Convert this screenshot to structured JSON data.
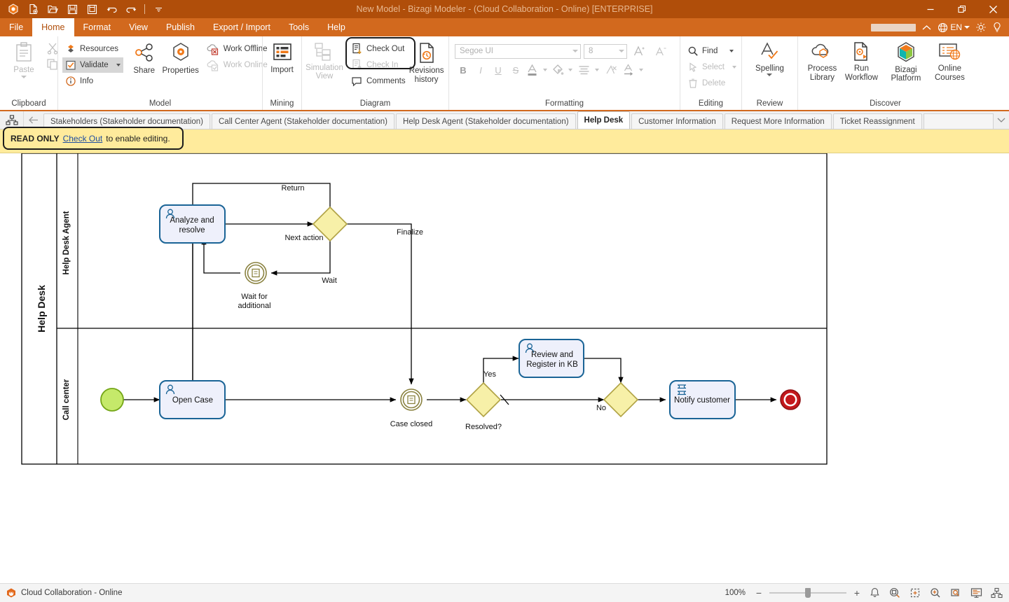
{
  "window": {
    "title": "New Model - Bizagi Modeler - (Cloud Collaboration - Online) [ENTERPRISE]",
    "minimize": "minimize-icon",
    "restore": "restore-icon",
    "close": "close-icon"
  },
  "quick_access": {
    "app_icon": "bizagi-logo-icon",
    "buttons": [
      {
        "name": "new-icon",
        "tooltip": "New"
      },
      {
        "name": "open-icon",
        "tooltip": "Open"
      },
      {
        "name": "save-icon",
        "tooltip": "Save"
      },
      {
        "name": "save-as-icon",
        "tooltip": "Save As"
      },
      {
        "name": "undo-icon",
        "tooltip": "Undo"
      },
      {
        "name": "redo-icon",
        "tooltip": "Redo"
      },
      {
        "name": "customize-qat-icon",
        "tooltip": "Customize Quick Access Toolbar"
      }
    ]
  },
  "menu": {
    "items": [
      {
        "label": "File",
        "active": false
      },
      {
        "label": "Home",
        "active": true
      },
      {
        "label": "Format",
        "active": false
      },
      {
        "label": "View",
        "active": false
      },
      {
        "label": "Publish",
        "active": false
      },
      {
        "label": "Export / Import",
        "active": false
      },
      {
        "label": "Tools",
        "active": false
      },
      {
        "label": "Help",
        "active": false
      }
    ],
    "right": {
      "user_redacted": "",
      "collapse_ribbon": "chevron-up-icon",
      "language": "EN",
      "settings": "gear-icon",
      "help": "lightbulb-icon"
    }
  },
  "ribbon": {
    "groups": [
      {
        "title": "Clipboard",
        "paste": "Paste",
        "cut": "cut-icon",
        "copy": "copy-icon"
      },
      {
        "title": "Model",
        "resources": "Resources",
        "validate": "Validate",
        "info": "Info",
        "share": "Share",
        "properties": "Properties",
        "work_offline": "Work Offline",
        "work_online": "Work Online"
      },
      {
        "title": "Mining",
        "import": "Import"
      },
      {
        "title": "Diagram",
        "simulation_view": "Simulation View",
        "check_out": "Check Out",
        "check_in": "Check In",
        "comments": "Comments",
        "revisions_history": "Revisions history"
      },
      {
        "title": "Formatting",
        "font_name": "Segoe UI",
        "font_size": "8",
        "grow_font": "grow-font-icon",
        "shrink_font": "shrink-font-icon",
        "bold": "B",
        "italic": "I",
        "underline": "U",
        "strikethrough": "S",
        "font_color": "A",
        "fill_color": "fill-color-icon",
        "align": "align-icon",
        "clear_format": "clear-formatting-icon",
        "text_direction": "A"
      },
      {
        "title": "Editing",
        "find": "Find",
        "select": "Select",
        "delete": "Delete"
      },
      {
        "title": "Review",
        "spelling": "Spelling"
      },
      {
        "title": "Discover",
        "process_library": "Process Library",
        "run_workflow": "Run Workflow",
        "bizagi_platform": "Bizagi Platform",
        "online_courses": "Online Courses"
      }
    ]
  },
  "tabbar": {
    "diagram_icon": "diagram-list-icon",
    "back_icon": "back-arrow-icon",
    "tabs": [
      {
        "label": "Stakeholders (Stakeholder documentation)",
        "active": false
      },
      {
        "label": "Call Center Agent  (Stakeholder documentation)",
        "active": false
      },
      {
        "label": "Help Desk Agent  (Stakeholder documentation)",
        "active": false
      },
      {
        "label": "Help Desk",
        "active": true
      },
      {
        "label": "Customer Information",
        "active": false
      },
      {
        "label": "Request More Information",
        "active": false
      },
      {
        "label": "Ticket Reassignment",
        "active": false
      }
    ],
    "overflow_icon": "chevron-down-icon"
  },
  "readonly_bar": {
    "status": "READ ONLY",
    "link": "Check Out",
    "suffix": "to enable editing."
  },
  "diagram": {
    "pool": "Help Desk",
    "lanes": [
      {
        "name": "Help Desk Agent"
      },
      {
        "name": "Call center"
      }
    ],
    "nodes": [
      {
        "id": "start",
        "type": "start-event",
        "label": ""
      },
      {
        "id": "open_case",
        "type": "user-task",
        "label": "Open Case"
      },
      {
        "id": "analyze",
        "type": "user-task",
        "label": "Analyze and resolve"
      },
      {
        "id": "next_action",
        "type": "exclusive-gateway",
        "label": "Next action"
      },
      {
        "id": "wait",
        "type": "intermediate-event",
        "label": "Wait for additional"
      },
      {
        "id": "case_closed",
        "type": "intermediate-event",
        "label": "Case closed"
      },
      {
        "id": "resolved",
        "type": "exclusive-gateway",
        "label": "Resolved?"
      },
      {
        "id": "review_kb",
        "type": "user-task",
        "label": "Review and Register in KB"
      },
      {
        "id": "merge",
        "type": "exclusive-gateway",
        "label": ""
      },
      {
        "id": "notify",
        "type": "script-task",
        "label": "Notify customer"
      },
      {
        "id": "end",
        "type": "end-event",
        "label": ""
      }
    ],
    "flow_labels": {
      "return": "Return",
      "finalize": "Finalize",
      "wait": "Wait",
      "yes": "Yes",
      "no": "No"
    },
    "colors": {
      "task_fill": "#eef0fb",
      "task_stroke": "#1a6496",
      "gateway_fill": "#f7f0a8",
      "gateway_stroke": "#b0a243",
      "start_fill": "#c5e96a",
      "start_stroke": "#74a617",
      "end_fill": "#c4191d",
      "end_stroke": "#8f1114",
      "event_stroke": "#8a8240"
    }
  },
  "statusbar": {
    "connection_icon": "cloud-lock-icon",
    "connection_label": "Cloud Collaboration - Online",
    "zoom_level": "100%",
    "zoom_out": "−",
    "zoom_in": "+",
    "icons": [
      {
        "name": "notifications-bell-icon"
      },
      {
        "name": "fit-page-icon"
      },
      {
        "name": "fit-width-icon"
      },
      {
        "name": "zoom-in-icon"
      },
      {
        "name": "zoom-selection-icon"
      },
      {
        "name": "presentation-view-icon"
      },
      {
        "name": "diagram-view-icon"
      }
    ]
  }
}
